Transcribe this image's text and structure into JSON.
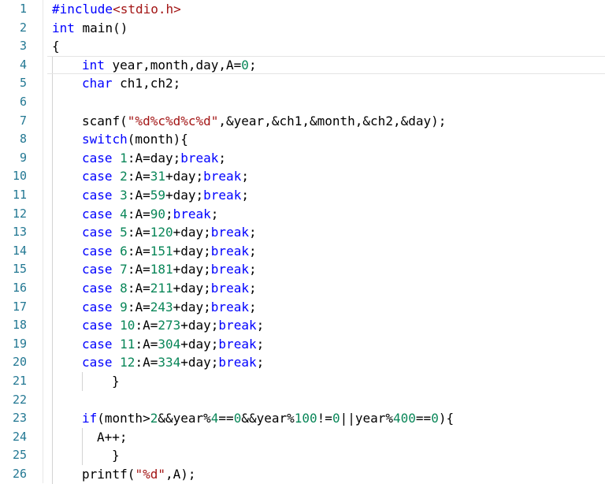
{
  "editor": {
    "colors": {
      "keyword": "#0000ff",
      "string": "#a31515",
      "number": "#098658",
      "line_number": "#237893",
      "text": "#000000"
    },
    "lines": [
      {
        "n": "1",
        "indent": 0,
        "tokens": [
          [
            "pre",
            "#include"
          ],
          [
            "inc",
            "<stdio.h>"
          ]
        ]
      },
      {
        "n": "2",
        "indent": 0,
        "tokens": [
          [
            "kw",
            "int"
          ],
          [
            "plain",
            " main()"
          ]
        ]
      },
      {
        "n": "3",
        "indent": 0,
        "tokens": [
          [
            "plain",
            "{"
          ]
        ]
      },
      {
        "n": "4",
        "indent": 1,
        "tokens": [
          [
            "kw",
            "int"
          ],
          [
            "plain",
            " year,month,day,A="
          ],
          [
            "num",
            "0"
          ],
          [
            "plain",
            ";"
          ]
        ],
        "current": true
      },
      {
        "n": "5",
        "indent": 1,
        "tokens": [
          [
            "kw",
            "char"
          ],
          [
            "plain",
            " ch1,ch2;"
          ]
        ]
      },
      {
        "n": "6",
        "indent": 1,
        "tokens": []
      },
      {
        "n": "7",
        "indent": 1,
        "tokens": [
          [
            "plain",
            "scanf("
          ],
          [
            "str",
            "\"%d%c%d%c%d\""
          ],
          [
            "plain",
            ",&year,&ch1,&month,&ch2,&day);"
          ]
        ]
      },
      {
        "n": "8",
        "indent": 1,
        "tokens": [
          [
            "kw",
            "switch"
          ],
          [
            "plain",
            "(month){"
          ]
        ]
      },
      {
        "n": "9",
        "indent": 1,
        "tokens": [
          [
            "kw",
            "case"
          ],
          [
            "plain",
            " "
          ],
          [
            "num",
            "1"
          ],
          [
            "plain",
            ":A=day;"
          ],
          [
            "kw",
            "break"
          ],
          [
            "plain",
            ";"
          ]
        ]
      },
      {
        "n": "10",
        "indent": 1,
        "tokens": [
          [
            "kw",
            "case"
          ],
          [
            "plain",
            " "
          ],
          [
            "num",
            "2"
          ],
          [
            "plain",
            ":A="
          ],
          [
            "num",
            "31"
          ],
          [
            "plain",
            "+day;"
          ],
          [
            "kw",
            "break"
          ],
          [
            "plain",
            ";"
          ]
        ]
      },
      {
        "n": "11",
        "indent": 1,
        "tokens": [
          [
            "kw",
            "case"
          ],
          [
            "plain",
            " "
          ],
          [
            "num",
            "3"
          ],
          [
            "plain",
            ":A="
          ],
          [
            "num",
            "59"
          ],
          [
            "plain",
            "+day;"
          ],
          [
            "kw",
            "break"
          ],
          [
            "plain",
            ";"
          ]
        ]
      },
      {
        "n": "12",
        "indent": 1,
        "tokens": [
          [
            "kw",
            "case"
          ],
          [
            "plain",
            " "
          ],
          [
            "num",
            "4"
          ],
          [
            "plain",
            ":A="
          ],
          [
            "num",
            "90"
          ],
          [
            "plain",
            ";"
          ],
          [
            "kw",
            "break"
          ],
          [
            "plain",
            ";"
          ]
        ]
      },
      {
        "n": "13",
        "indent": 1,
        "tokens": [
          [
            "kw",
            "case"
          ],
          [
            "plain",
            " "
          ],
          [
            "num",
            "5"
          ],
          [
            "plain",
            ":A="
          ],
          [
            "num",
            "120"
          ],
          [
            "plain",
            "+day;"
          ],
          [
            "kw",
            "break"
          ],
          [
            "plain",
            ";"
          ]
        ]
      },
      {
        "n": "14",
        "indent": 1,
        "tokens": [
          [
            "kw",
            "case"
          ],
          [
            "plain",
            " "
          ],
          [
            "num",
            "6"
          ],
          [
            "plain",
            ":A="
          ],
          [
            "num",
            "151"
          ],
          [
            "plain",
            "+day;"
          ],
          [
            "kw",
            "break"
          ],
          [
            "plain",
            ";"
          ]
        ]
      },
      {
        "n": "15",
        "indent": 1,
        "tokens": [
          [
            "kw",
            "case"
          ],
          [
            "plain",
            " "
          ],
          [
            "num",
            "7"
          ],
          [
            "plain",
            ":A="
          ],
          [
            "num",
            "181"
          ],
          [
            "plain",
            "+day;"
          ],
          [
            "kw",
            "break"
          ],
          [
            "plain",
            ";"
          ]
        ]
      },
      {
        "n": "16",
        "indent": 1,
        "tokens": [
          [
            "kw",
            "case"
          ],
          [
            "plain",
            " "
          ],
          [
            "num",
            "8"
          ],
          [
            "plain",
            ":A="
          ],
          [
            "num",
            "211"
          ],
          [
            "plain",
            "+day;"
          ],
          [
            "kw",
            "break"
          ],
          [
            "plain",
            ";"
          ]
        ]
      },
      {
        "n": "17",
        "indent": 1,
        "tokens": [
          [
            "kw",
            "case"
          ],
          [
            "plain",
            " "
          ],
          [
            "num",
            "9"
          ],
          [
            "plain",
            ":A="
          ],
          [
            "num",
            "243"
          ],
          [
            "plain",
            "+day;"
          ],
          [
            "kw",
            "break"
          ],
          [
            "plain",
            ";"
          ]
        ]
      },
      {
        "n": "18",
        "indent": 1,
        "tokens": [
          [
            "kw",
            "case"
          ],
          [
            "plain",
            " "
          ],
          [
            "num",
            "10"
          ],
          [
            "plain",
            ":A="
          ],
          [
            "num",
            "273"
          ],
          [
            "plain",
            "+day;"
          ],
          [
            "kw",
            "break"
          ],
          [
            "plain",
            ";"
          ]
        ]
      },
      {
        "n": "19",
        "indent": 1,
        "tokens": [
          [
            "kw",
            "case"
          ],
          [
            "plain",
            " "
          ],
          [
            "num",
            "11"
          ],
          [
            "plain",
            ":A="
          ],
          [
            "num",
            "304"
          ],
          [
            "plain",
            "+day;"
          ],
          [
            "kw",
            "break"
          ],
          [
            "plain",
            ";"
          ]
        ]
      },
      {
        "n": "20",
        "indent": 1,
        "tokens": [
          [
            "kw",
            "case"
          ],
          [
            "plain",
            " "
          ],
          [
            "num",
            "12"
          ],
          [
            "plain",
            ":A="
          ],
          [
            "num",
            "334"
          ],
          [
            "plain",
            "+day;"
          ],
          [
            "kw",
            "break"
          ],
          [
            "plain",
            ";"
          ]
        ]
      },
      {
        "n": "21",
        "indent": 2,
        "tokens": [
          [
            "plain",
            "}"
          ]
        ]
      },
      {
        "n": "22",
        "indent": 1,
        "tokens": []
      },
      {
        "n": "23",
        "indent": 1,
        "tokens": [
          [
            "kw",
            "if"
          ],
          [
            "plain",
            "(month>"
          ],
          [
            "num",
            "2"
          ],
          [
            "plain",
            "&&year%"
          ],
          [
            "num",
            "4"
          ],
          [
            "plain",
            "=="
          ],
          [
            "num",
            "0"
          ],
          [
            "plain",
            "&&year%"
          ],
          [
            "num",
            "100"
          ],
          [
            "plain",
            "!="
          ],
          [
            "num",
            "0"
          ],
          [
            "plain",
            "||year%"
          ],
          [
            "num",
            "400"
          ],
          [
            "plain",
            "=="
          ],
          [
            "num",
            "0"
          ],
          [
            "plain",
            "){"
          ]
        ]
      },
      {
        "n": "24",
        "indent": 1.5,
        "tokens": [
          [
            "plain",
            "A++;"
          ]
        ]
      },
      {
        "n": "25",
        "indent": 2,
        "tokens": [
          [
            "plain",
            "}"
          ]
        ]
      },
      {
        "n": "26",
        "indent": 1,
        "tokens": [
          [
            "plain",
            "printf("
          ],
          [
            "str",
            "\"%d\""
          ],
          [
            "plain",
            ",A);"
          ]
        ]
      }
    ]
  }
}
